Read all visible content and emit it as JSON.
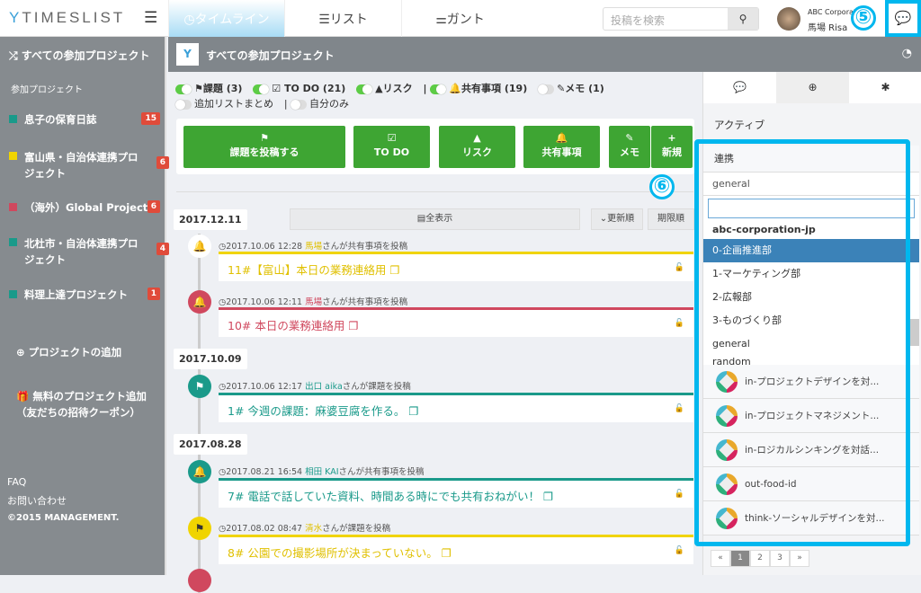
{
  "topbar": {
    "logo": "TIMESLIST",
    "nav": [
      {
        "label": "◷タイムライン"
      },
      {
        "label": "☰リスト"
      },
      {
        "label": "⚌ガント"
      }
    ],
    "search_placeholder": "投稿を検索",
    "company": "ABC Corporat",
    "user": "馬場 Risa",
    "callout5": "⑤"
  },
  "sidebar": {
    "title": "すべての参加プロジェクト",
    "section": "参加プロジェクト",
    "projects": [
      {
        "name": "息子の保育日誌",
        "count": "15",
        "color": "#1a9a8a"
      },
      {
        "name": "富山県・自治体連携プロジェクト",
        "count": "6",
        "color": "#f0d400"
      },
      {
        "name": "（海外）Global Project",
        "count": "6",
        "color": "#d0485e"
      },
      {
        "name": "北杜市・自治体連携プロジェクト",
        "count": "4",
        "color": "#1a9a8a"
      },
      {
        "name": "料理上達プロジェクト",
        "count": "1",
        "color": "#1a9a8a"
      }
    ],
    "add_project": "プロジェクトの追加",
    "free_add": "無料のプロジェクト追加（友だちの招待クーポン）",
    "faq": "FAQ",
    "contact": "お問い合わせ",
    "copyright": "©2015 MANAGEMENT."
  },
  "header": {
    "title": "すべての参加プロジェクト"
  },
  "filters": [
    {
      "label": "⚑課題 (3)",
      "on": true
    },
    {
      "label": "☑ TO DO (21)",
      "on": true
    },
    {
      "label": "▲リスク",
      "on": true
    },
    {
      "label": "🔔共有事項 (19)",
      "on": true
    },
    {
      "label": "✎メモ (1)",
      "on": false
    },
    {
      "label": "追加リストまとめ",
      "on": false
    },
    {
      "label": "自分のみ",
      "on": false
    }
  ],
  "actions": [
    {
      "icon": "⚑",
      "label": "課題を投稿する"
    },
    {
      "icon": "☑",
      "label": "TO DO"
    },
    {
      "icon": "▲",
      "label": "リスク"
    },
    {
      "icon": "🔔",
      "label": "共有事項"
    },
    {
      "icon": "✎",
      "label": "メモ"
    },
    {
      "icon": "+",
      "label": "新規"
    }
  ],
  "callout6": "⑥",
  "timeline": {
    "show_all": "▤全表示",
    "sort_updated": "⌄更新順",
    "sort_due": "期限順",
    "dates": [
      "2017.12.11",
      "2017.10.09",
      "2017.08.28"
    ],
    "items": [
      {
        "time": "◷2017.10.06 12:28",
        "user": "馬場",
        "action": "さんが共有事項を投稿",
        "title": "11#【富山】本日の業務連絡用",
        "color": "#f0d400",
        "icon": "🔔"
      },
      {
        "time": "◷2017.10.06 12:11",
        "user": "馬場",
        "action": "さんが共有事項を投稿",
        "title": "10# 本日の業務連絡用",
        "color": "#d0485e",
        "icon": "🔔"
      },
      {
        "time": "◷2017.10.06 12:17",
        "user": "出口 aika",
        "action": "さんが課題を投稿",
        "title": "1# 今週の課題：麻婆豆腐を作る。",
        "color": "#1a9a8a",
        "icon": "⚑"
      },
      {
        "time": "◷2017.08.21 16:54",
        "user": "相田 KAI",
        "action": "さんが共有事項を投稿",
        "title": "7# 電話で話していた資料、時間ある時にでも共有おねがい！",
        "color": "#1a9a8a",
        "icon": "🔔"
      },
      {
        "time": "◷2017.08.02 08:47",
        "user": "清水",
        "action": "さんが課題を投稿",
        "title": "8# 公園での撮影場所が決まっていない。",
        "color": "#f0d400",
        "icon": "⚑"
      }
    ]
  },
  "right": {
    "active": "アクティブ",
    "integration": "連携",
    "select_value": "general",
    "group": "abc-corporation-jp",
    "options": [
      "0-企画推進部",
      "1-マーケティング部",
      "2-広報部",
      "3-ものづくり部",
      "general",
      "random"
    ],
    "channels": [
      "in-プロジェクトデザインを対...",
      "in-プロジェクトマネジメント...",
      "in-ロジカルシンキングを対話...",
      "out-food-id",
      "think-ソーシャルデザインを対..."
    ],
    "pages": [
      "«",
      "1",
      "2",
      "3",
      "»"
    ]
  }
}
